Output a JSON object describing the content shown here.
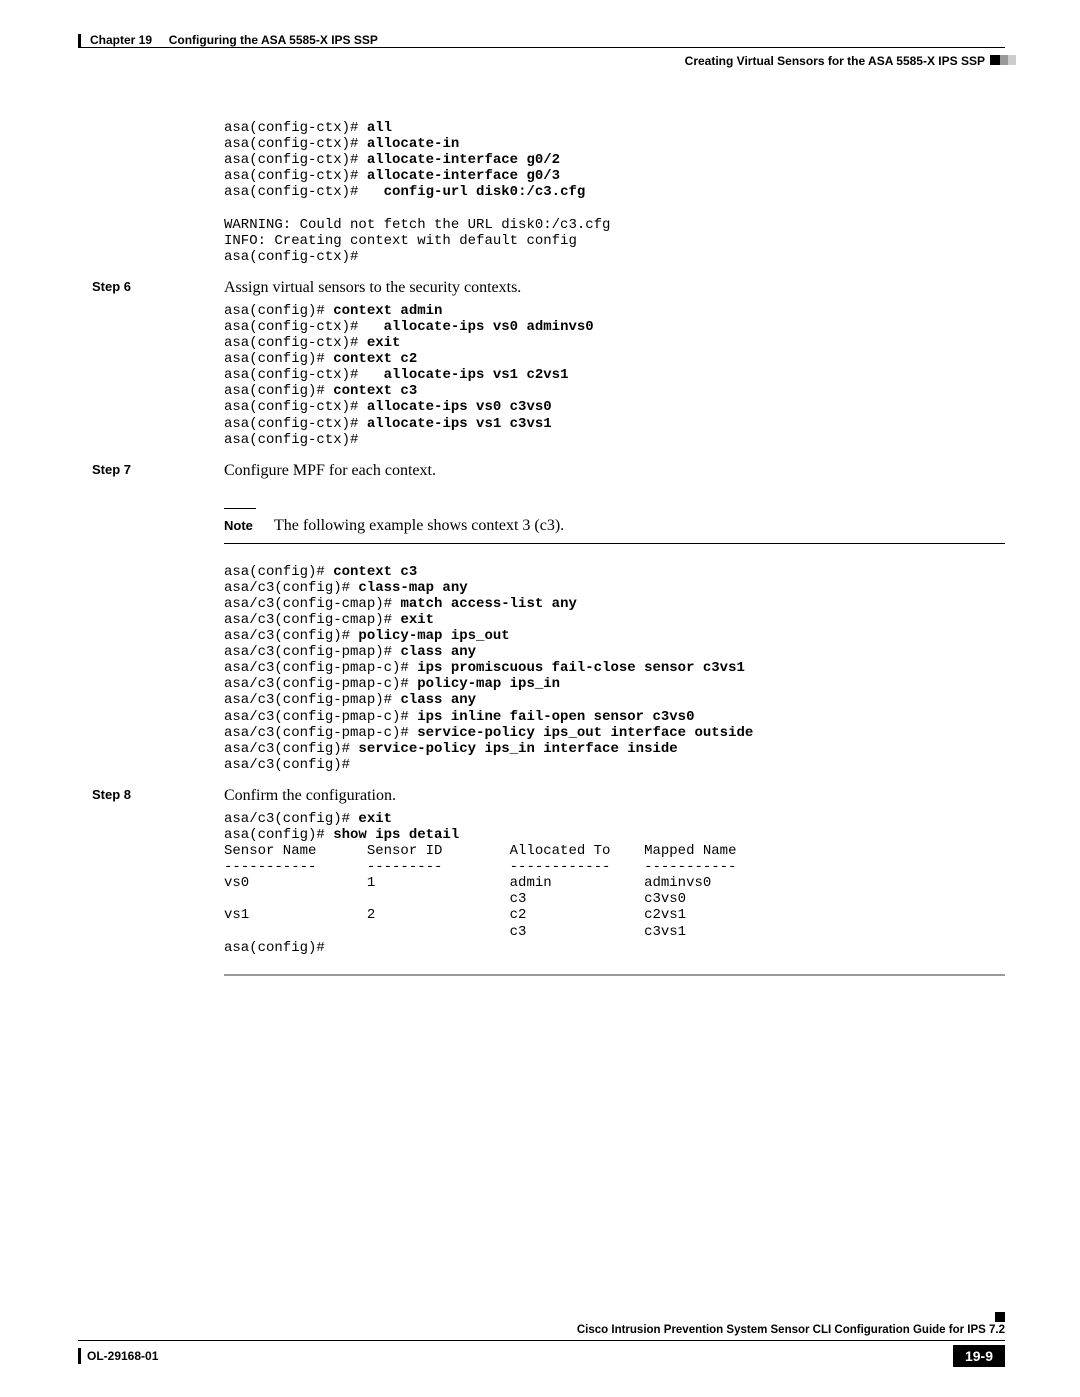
{
  "header": {
    "chapter": "Chapter 19",
    "title": "Configuring the ASA 5585-X IPS SSP",
    "subheader": "Creating Virtual Sensors for the ASA 5585-X IPS SSP"
  },
  "code1": {
    "l1p": "asa(config-ctx)# ",
    "l1b": "all",
    "l2p": "asa(config-ctx)# ",
    "l2b": "allocate-in",
    "l3p": "asa(config-ctx)# ",
    "l3b": "allocate-interface g0/2",
    "l4p": "asa(config-ctx)# ",
    "l4b": "allocate-interface g0/3",
    "l5p": "asa(config-ctx)#   ",
    "l5b": "config-url disk0:/c3.cfg",
    "blank": "",
    "l6": "WARNING: Could not fetch the URL disk0:/c3.cfg",
    "l7": "INFO: Creating context with default config",
    "l8": "asa(config-ctx)#"
  },
  "step6": {
    "label": "Step 6",
    "text": "Assign virtual sensors to the security contexts."
  },
  "code2": {
    "l1p": "asa(config)# ",
    "l1b": "context admin",
    "l2p": "asa(config-ctx)#   ",
    "l2b": "allocate-ips vs0 adminvs0",
    "l3p": "asa(config-ctx)# ",
    "l3b": "exit",
    "l4p": "asa(config)# ",
    "l4b": "context c2",
    "l5p": "asa(config-ctx)#   ",
    "l5b": "allocate-ips vs1 c2vs1",
    "l6p": "asa(config)# ",
    "l6b": "context c3",
    "l7p": "asa(config-ctx)# ",
    "l7b": "allocate-ips vs0 c3vs0",
    "l8p": "asa(config-ctx)# ",
    "l8b": "allocate-ips vs1 c3vs1",
    "l9": "asa(config-ctx)#"
  },
  "step7": {
    "label": "Step 7",
    "text": "Configure MPF for each context."
  },
  "note": {
    "label": "Note",
    "text": "The following example shows context 3 (c3)."
  },
  "code3": {
    "l1p": "asa(config)# ",
    "l1b": "context c3",
    "l2p": "asa/c3(config)# ",
    "l2b": "class-map any",
    "l3p": "asa/c3(config-cmap)# ",
    "l3b": "match access-list any",
    "l4p": "asa/c3(config-cmap)# ",
    "l4b": "exit",
    "l5p": "asa/c3(config)# ",
    "l5b": "policy-map ips_out",
    "l6p": "asa/c3(config-pmap)# ",
    "l6b": "class any",
    "l7p": "asa/c3(config-pmap-c)# ",
    "l7b": "ips promiscuous fail-close sensor c3vs1",
    "l8p": "asa/c3(config-pmap-c)# ",
    "l8b": "policy-map ips_in",
    "l9p": "asa/c3(config-pmap)# ",
    "l9b": "class any",
    "l10p": "asa/c3(config-pmap-c)# ",
    "l10b": "ips inline fail-open sensor c3vs0",
    "l11p": "asa/c3(config-pmap-c)# ",
    "l11b": "service-policy ips_out interface outside",
    "l12p": "asa/c3(config)# ",
    "l12b": "service-policy ips_in interface inside",
    "l13": "asa/c3(config)#"
  },
  "step8": {
    "label": "Step 8",
    "text": "Confirm the configuration."
  },
  "code4": {
    "l1p": "asa/c3(config)# ",
    "l1b": "exit",
    "l2p": "asa(config)# ",
    "l2b": "show ips detail",
    "l3": "Sensor Name      Sensor ID        Allocated To    Mapped Name",
    "l4": "-----------      ---------        ------------    -----------",
    "l5": "vs0              1                admin           adminvs0",
    "l6": "                                  c3              c3vs0",
    "l7": "vs1              2                c2              c2vs1",
    "l8": "                                  c3              c3vs1",
    "l9": "asa(config)#"
  },
  "footer": {
    "guide": "Cisco Intrusion Prevention System Sensor CLI Configuration Guide for IPS 7.2",
    "docnum": "OL-29168-01",
    "page": "19-9"
  }
}
